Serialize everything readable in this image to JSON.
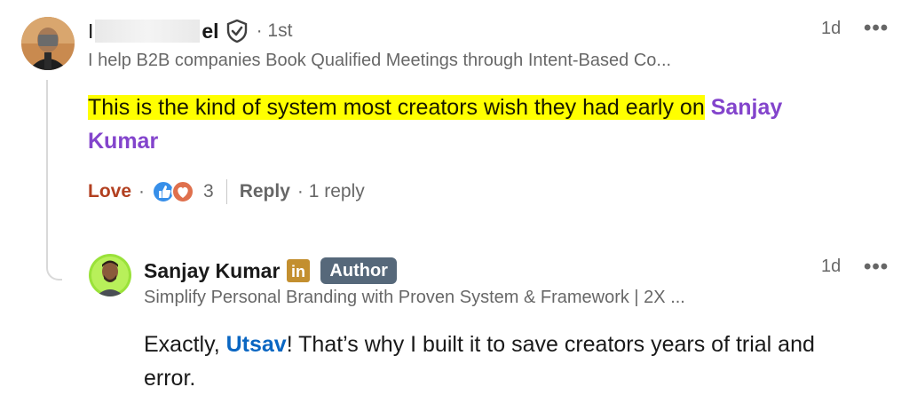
{
  "comment": {
    "author_visible": "el",
    "author_leading": "I",
    "degree": "· 1st",
    "headline": "I help B2B companies Book Qualified Meetings through Intent-Based Co...",
    "time": "1d",
    "more": "•••",
    "text_highlighted": "This is the kind of system most creators wish they had early on",
    "mention_first": "Sanjay",
    "mention_second": "Kumar",
    "reaction_label": "Love",
    "dot": "·",
    "reaction_count": "3",
    "reply_label": "Reply",
    "reply_count": "· 1 reply"
  },
  "reply": {
    "author": "Sanjay Kumar",
    "author_badge": "Author",
    "linkedin_badge": "in",
    "headline": "Simplify Personal Branding with Proven System & Framework | 2X ...",
    "time": "1d",
    "more": "•••",
    "text_before": "Exactly,",
    "mention": "Utsav",
    "text_after_line1": "! That’s why I built it to save creators years of trial and",
    "text_line2": "error."
  },
  "colors": {
    "highlight": "#ffff00",
    "mention_purple": "#8344cc",
    "mention_blue": "#0a66c2",
    "love_red": "#b24020",
    "author_badge_bg": "#56687a"
  }
}
